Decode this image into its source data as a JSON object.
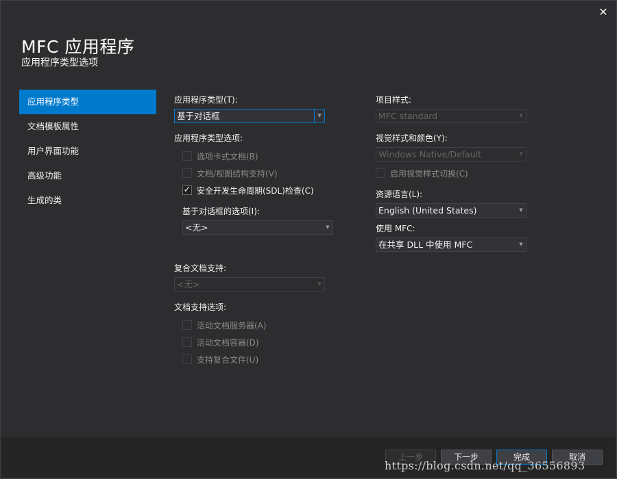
{
  "window": {
    "close_glyph": "✕"
  },
  "header": {
    "title": "MFC 应用程序",
    "subtitle": "应用程序类型选项"
  },
  "sidebar": {
    "items": [
      {
        "label": "应用程序类型",
        "active": true
      },
      {
        "label": "文档模板属性",
        "active": false
      },
      {
        "label": "用户界面功能",
        "active": false
      },
      {
        "label": "高级功能",
        "active": false
      },
      {
        "label": "生成的类",
        "active": false
      }
    ]
  },
  "left": {
    "app_type_label": "应用程序类型(T):",
    "app_type_value": "基于对话框",
    "app_type_options_label": "应用程序类型选项:",
    "options": [
      {
        "label": "选项卡式文档(B)",
        "checked": false,
        "enabled": false
      },
      {
        "label": "文档/视图结构支持(V)",
        "checked": false,
        "enabled": false
      },
      {
        "label": "安全开发生命周期(SDL)检查(C)",
        "checked": true,
        "enabled": true
      }
    ],
    "dialog_options_label": "基于对话框的选项(I):",
    "dialog_options_value": "<无>",
    "compound_label": "复合文档支持:",
    "compound_value": "<无>",
    "doc_support_label": "文档支持选项:",
    "doc_support": [
      {
        "label": "活动文档服务器(A)",
        "checked": false,
        "enabled": false
      },
      {
        "label": "活动文档容器(D)",
        "checked": false,
        "enabled": false
      },
      {
        "label": "支持复合文件(U)",
        "checked": false,
        "enabled": false
      }
    ]
  },
  "right": {
    "project_style_label": "项目样式:",
    "project_style_value": "MFC standard",
    "visual_style_label": "视觉样式和颜色(Y):",
    "visual_style_value": "Windows Native/Default",
    "visual_switch_label": "启用视觉样式切换(C)",
    "resource_lang_label": "资源语言(L):",
    "resource_lang_value": "English (United States)",
    "use_mfc_label": "使用 MFC:",
    "use_mfc_value": "在共享 DLL 中使用 MFC"
  },
  "footer": {
    "prev": "上一步",
    "next": "下一步",
    "finish": "完成",
    "cancel": "取消"
  },
  "watermark": "https://blog.csdn.net/qq_36556893",
  "icons": {
    "dropdown_arrow": "▼",
    "check": "✓"
  },
  "colors": {
    "background": "#2d2d30",
    "accent": "#007acc",
    "footer": "#252526"
  }
}
